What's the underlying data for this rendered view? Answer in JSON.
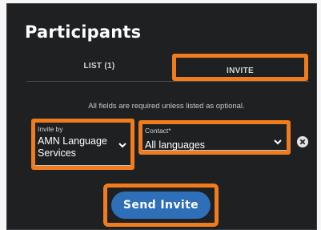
{
  "header": {
    "title": "Participants"
  },
  "tabs": [
    {
      "label": "LIST (1)"
    },
    {
      "label": "INVITE"
    }
  ],
  "form": {
    "note": "All fields are required unless listed as optional.",
    "invite_by": {
      "label": "Invite by",
      "value": "AMN Language Services"
    },
    "contact": {
      "label": "Contact*",
      "value": "All languages"
    }
  },
  "actions": {
    "send_label": "Send Invite"
  },
  "colors": {
    "panel_bg": "#1e2021",
    "highlight": "#f07c1d",
    "button": "#2f6fb7"
  },
  "icons": [
    "chevron-down-icon",
    "chevron-down-icon",
    "clear-icon"
  ]
}
